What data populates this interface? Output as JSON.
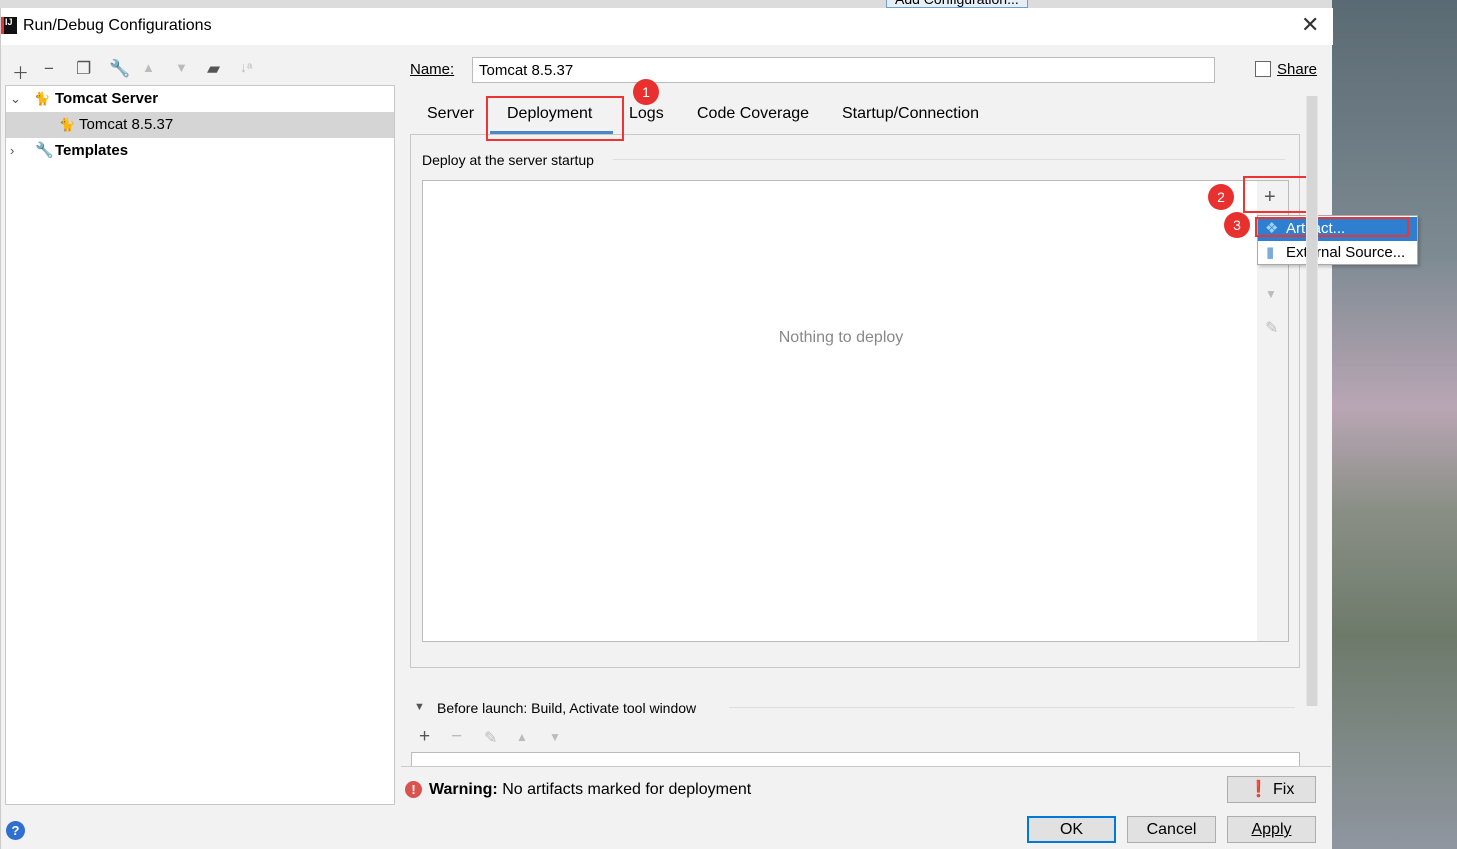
{
  "background_toolbar": {
    "add_configuration": "Add Configuration..."
  },
  "window": {
    "title": "Run/Debug Configurations"
  },
  "tree": {
    "items": [
      {
        "label": "Tomcat Server",
        "expanded": true,
        "icon": "tomcat-icon"
      },
      {
        "label": "Tomcat 8.5.37",
        "selected": true,
        "icon": "tomcat-error-icon"
      },
      {
        "label": "Templates",
        "expanded": false,
        "icon": "wrench-icon"
      }
    ]
  },
  "toolbar": {
    "icons": [
      "plus-icon",
      "minus-icon",
      "copy-icon",
      "wrench-icon",
      "arrow-up-icon",
      "arrow-down-icon",
      "new-folder-icon",
      "sort-alpha-icon"
    ]
  },
  "name": {
    "label": "Name:",
    "value": "Tomcat 8.5.37"
  },
  "share": {
    "label": "Share",
    "checked": false
  },
  "tabs": [
    {
      "label": "Server"
    },
    {
      "label": "Deployment",
      "active": true
    },
    {
      "label": "Logs"
    },
    {
      "label": "Code Coverage"
    },
    {
      "label": "Startup/Connection"
    }
  ],
  "deployment": {
    "section_label": "Deploy at the server startup",
    "empty_text": "Nothing to deploy"
  },
  "add_menu": {
    "items": [
      {
        "label": "Artifact...",
        "highlighted": true
      },
      {
        "label": "External Source..."
      }
    ]
  },
  "annotations": {
    "badges": [
      "1",
      "2",
      "3"
    ],
    "color": "#e8302f"
  },
  "before_launch": {
    "label": "Before launch: Build, Activate tool window"
  },
  "warning": {
    "bold": "Warning:",
    "text": "No artifacts marked for deployment"
  },
  "buttons": {
    "fix": "Fix",
    "ok": "OK",
    "cancel": "Cancel",
    "apply": "Apply"
  },
  "colors": {
    "accent": "#4a88c7",
    "selection": "#2f7fd0",
    "annotation": "#e33333"
  }
}
